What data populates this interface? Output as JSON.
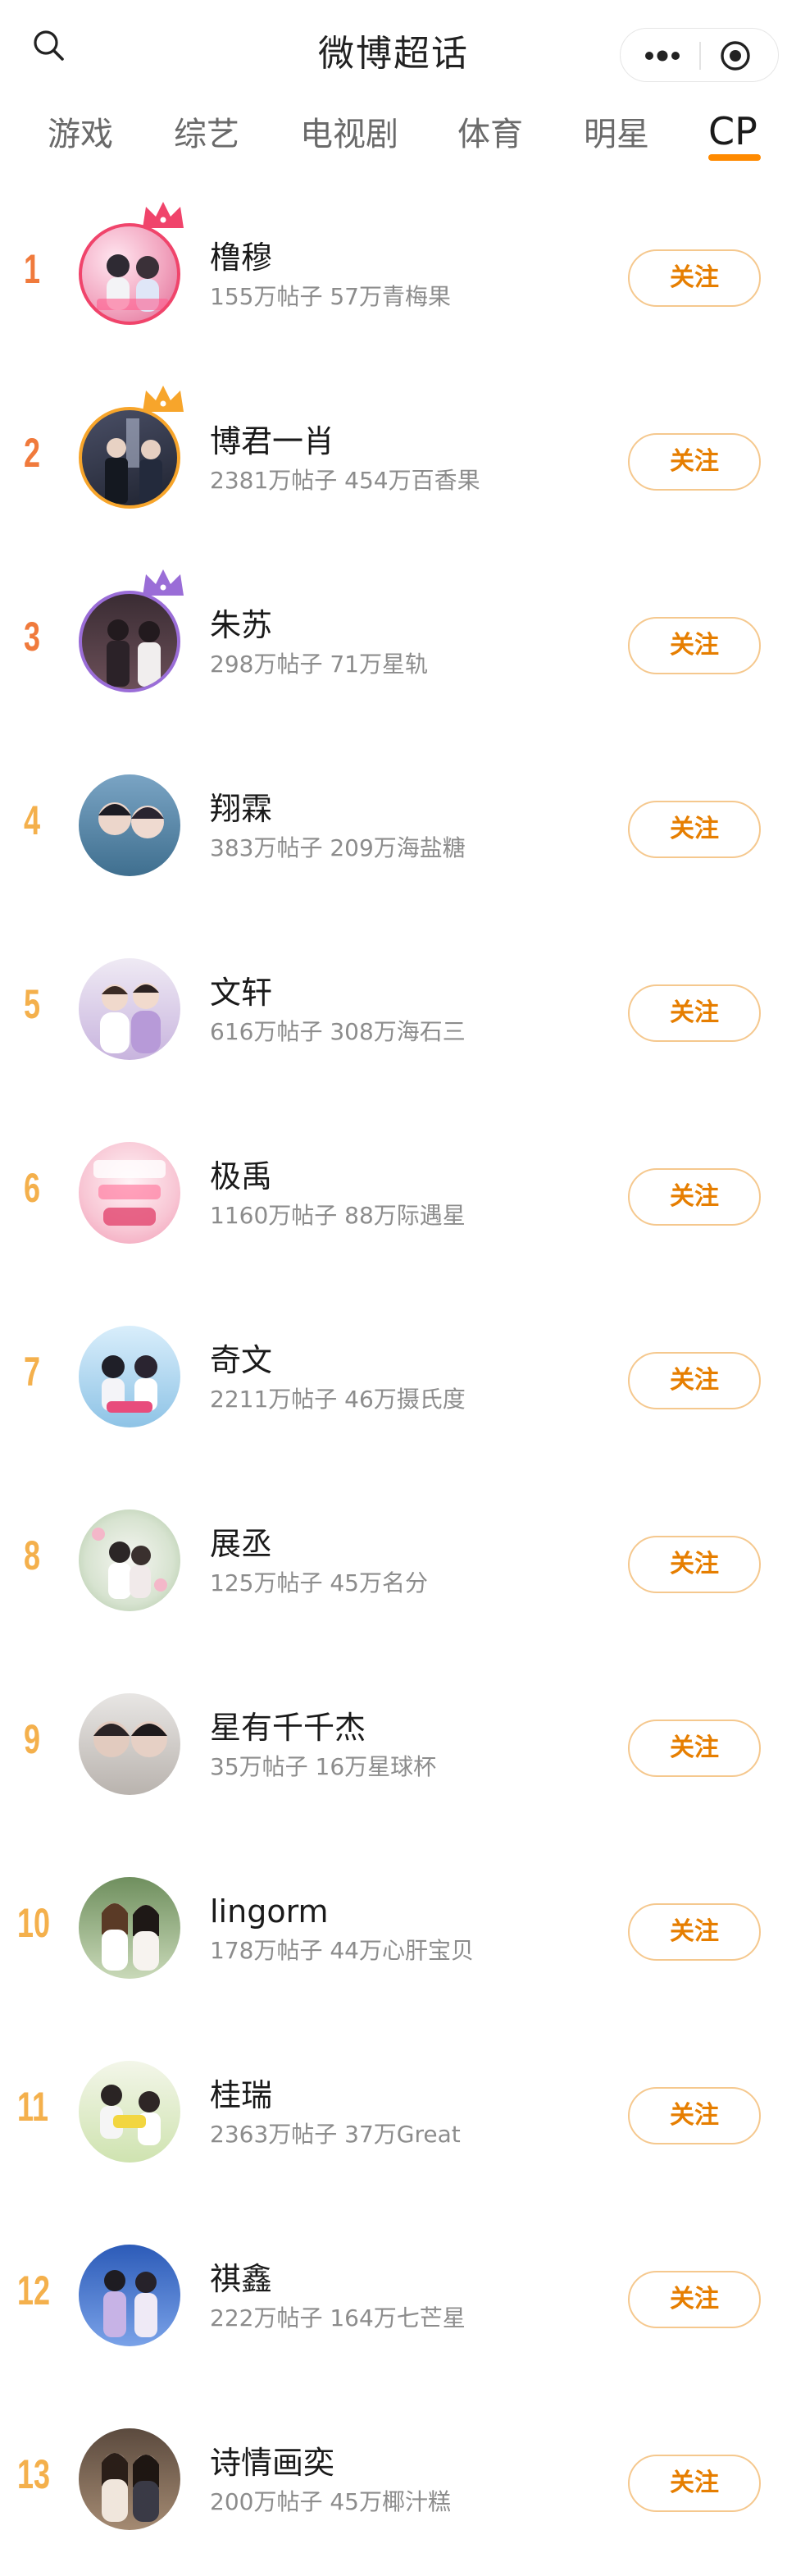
{
  "header": {
    "title": "微博超话",
    "search_icon": "search-icon",
    "more_icon": "more-icon",
    "target_icon": "target-icon"
  },
  "tabs": [
    {
      "label": "游戏",
      "active": false
    },
    {
      "label": "综艺",
      "active": false
    },
    {
      "label": "电视剧",
      "active": false
    },
    {
      "label": "体育",
      "active": false
    },
    {
      "label": "明星",
      "active": false
    },
    {
      "label": "CP",
      "active": true
    }
  ],
  "colors": {
    "accent": "#ff8a00",
    "button_text": "#e67e00",
    "button_border": "#f5c88e",
    "rank_top3": "#f07a3c",
    "rank_rest": "#f4b04c",
    "crown_1": "#f0446b",
    "crown_2": "#f7a52b",
    "crown_3": "#9a6dd7"
  },
  "items": [
    {
      "rank": "1",
      "name": "橹穆",
      "stats": "155万帖子 57万青梅果",
      "follow": "关注"
    },
    {
      "rank": "2",
      "name": "博君一肖",
      "stats": "2381万帖子 454万百香果",
      "follow": "关注"
    },
    {
      "rank": "3",
      "name": "朱苏",
      "stats": "298万帖子 71万星轨",
      "follow": "关注"
    },
    {
      "rank": "4",
      "name": "翔霖",
      "stats": "383万帖子 209万海盐糖",
      "follow": "关注"
    },
    {
      "rank": "5",
      "name": "文轩",
      "stats": "616万帖子 308万海石三",
      "follow": "关注"
    },
    {
      "rank": "6",
      "name": "极禹",
      "stats": "1160万帖子 88万际遇星",
      "follow": "关注"
    },
    {
      "rank": "7",
      "name": "奇文",
      "stats": "2211万帖子 46万摄氏度",
      "follow": "关注"
    },
    {
      "rank": "8",
      "name": "展丞",
      "stats": "125万帖子 45万名分",
      "follow": "关注"
    },
    {
      "rank": "9",
      "name": "星有千千杰",
      "stats": "35万帖子 16万星球杯",
      "follow": "关注"
    },
    {
      "rank": "10",
      "name": "lingorm",
      "stats": "178万帖子 44万心肝宝贝",
      "follow": "关注"
    },
    {
      "rank": "11",
      "name": "桂瑞",
      "stats": "2363万帖子 37万Great",
      "follow": "关注"
    },
    {
      "rank": "12",
      "name": "祺鑫",
      "stats": "222万帖子 164万七芒星",
      "follow": "关注"
    },
    {
      "rank": "13",
      "name": "诗情画奕",
      "stats": "200万帖子 45万椰汁糕",
      "follow": "关注"
    }
  ]
}
